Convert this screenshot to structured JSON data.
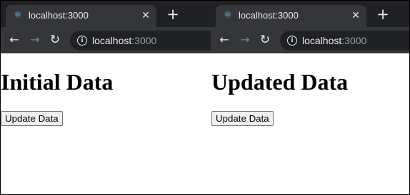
{
  "left_window": {
    "tab": {
      "favicon": "react-icon",
      "title": "localhost:3000",
      "close_icon": "close-icon"
    },
    "new_tab_icon": "plus-icon",
    "toolbar": {
      "back_icon": "back-arrow-icon",
      "forward_icon": "forward-arrow-icon",
      "reload_icon": "reload-icon"
    },
    "address_bar": {
      "info_icon": "info-icon",
      "host": "localhost",
      "port": ":3000"
    },
    "page": {
      "heading": "Initial Data",
      "button_label": "Update Data"
    }
  },
  "right_window": {
    "tab": {
      "favicon": "react-icon",
      "title": "localhost:3000",
      "close_icon": "close-icon"
    },
    "new_tab_icon": "plus-icon",
    "toolbar": {
      "back_icon": "back-arrow-icon",
      "forward_icon": "forward-arrow-icon",
      "reload_icon": "reload-icon"
    },
    "address_bar": {
      "info_icon": "info-icon",
      "host": "localhost",
      "port": ":3000"
    },
    "page": {
      "heading": "Updated Data",
      "button_label": "Update Data"
    }
  },
  "colors": {
    "tabstrip": "#202124",
    "active_tab": "#35363a",
    "omnibox": "#202124",
    "react_blue": "#61dafb",
    "text_light": "#e8eaed",
    "text_dim": "#9aa0a6"
  }
}
